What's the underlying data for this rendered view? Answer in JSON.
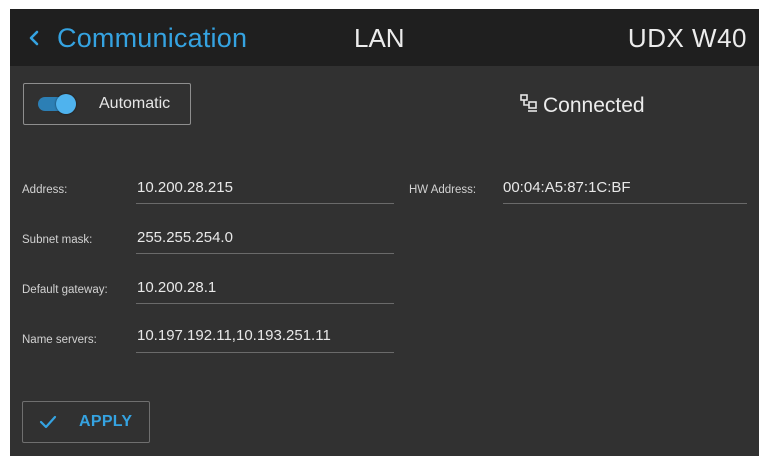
{
  "header": {
    "back_label": "Communication",
    "center_title": "LAN",
    "device_name": "UDX W40"
  },
  "mode_toggle": {
    "label": "Automatic",
    "state": "on"
  },
  "connection": {
    "icon": "network-icon",
    "status": "Connected"
  },
  "fields": {
    "address": {
      "label": "Address:",
      "value": "10.200.28.215"
    },
    "subnet_mask": {
      "label": "Subnet mask:",
      "value": "255.255.254.0"
    },
    "default_gateway": {
      "label": "Default gateway:",
      "value": "10.200.28.1"
    },
    "name_servers": {
      "label": "Name servers:",
      "value": "10.197.192.11,10.193.251.11"
    },
    "hw_address": {
      "label": "HW Address:",
      "value": "00:04:A5:87:1C:BF"
    }
  },
  "apply": {
    "icon": "check-icon",
    "label": "APPLY"
  },
  "colors": {
    "accent": "#35a3e1",
    "background": "#313131",
    "header_background": "#1f1f1f"
  }
}
